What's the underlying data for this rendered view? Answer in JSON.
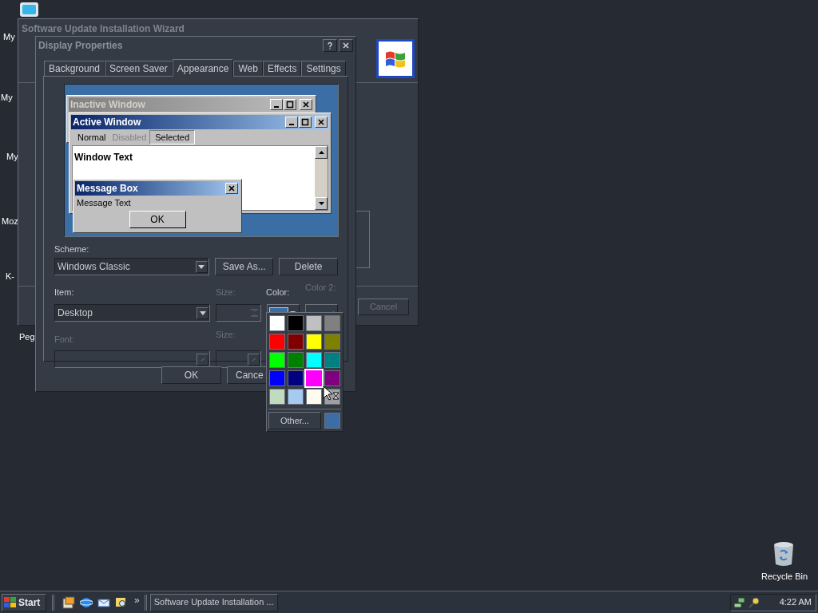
{
  "desktop_icons": [
    {
      "label": "My"
    },
    {
      "label": "My"
    },
    {
      "label": "My"
    },
    {
      "label": "Moz"
    },
    {
      "label": "K-"
    },
    {
      "label": "Peg"
    }
  ],
  "wizard": {
    "title": "Software Update Installation Wizard",
    "cancel": {
      "label": "Cancel",
      "disabled": true
    }
  },
  "dialog": {
    "title": "Display Properties",
    "tabs": [
      {
        "label": "Background",
        "selected": false
      },
      {
        "label": "Screen Saver",
        "selected": false
      },
      {
        "label": "Appearance",
        "selected": true
      },
      {
        "label": "Web",
        "selected": false
      },
      {
        "label": "Effects",
        "selected": false
      },
      {
        "label": "Settings",
        "selected": false
      }
    ],
    "preview": {
      "inactive_title": "Inactive Window",
      "active_title": "Active Window",
      "menu": [
        {
          "label": "Normal",
          "kind": "normal"
        },
        {
          "label": "Disabled",
          "kind": "disabled"
        },
        {
          "label": "Selected",
          "kind": "selected"
        }
      ],
      "window_text": "Window Text",
      "message_title": "Message Box",
      "message_text": "Message Text",
      "ok": "OK"
    },
    "scheme": {
      "label": "Scheme:",
      "value": "Windows Classic"
    },
    "save_as": "Save As...",
    "delete": "Delete",
    "item": {
      "label": "Item:",
      "value": "Desktop"
    },
    "item_size": {
      "label": "Size:",
      "disabled": true
    },
    "color": {
      "label": "Color:",
      "color": "#3a6ea5"
    },
    "color2": {
      "label": "Color 2:",
      "disabled": true
    },
    "font": {
      "label": "Font:",
      "disabled": true
    },
    "font_size": {
      "label": "Size:",
      "disabled": true
    },
    "buttons": [
      "OK",
      "Cance"
    ]
  },
  "color_menu": {
    "swatches": [
      {
        "color": "#ffffff",
        "selected": false
      },
      {
        "color": "#000000",
        "selected": false
      },
      {
        "color": "#c0c0c0",
        "selected": false
      },
      {
        "color": "#808080",
        "selected": false
      },
      {
        "color": "#ff0000",
        "selected": false
      },
      {
        "color": "#800000",
        "selected": false
      },
      {
        "color": "#ffff00",
        "selected": false
      },
      {
        "color": "#808000",
        "selected": false
      },
      {
        "color": "#00ff00",
        "selected": false
      },
      {
        "color": "#008000",
        "selected": false
      },
      {
        "color": "#00ffff",
        "selected": false
      },
      {
        "color": "#008080",
        "selected": false
      },
      {
        "color": "#0000ff",
        "selected": false
      },
      {
        "color": "#000080",
        "selected": false
      },
      {
        "color": "#ff00ff",
        "selected": true
      },
      {
        "color": "#800080",
        "selected": false
      },
      {
        "color": "#c0dcc0",
        "selected": false
      },
      {
        "color": "#a6caf0",
        "selected": false
      },
      {
        "color": "#fffbf0",
        "selected": false
      },
      {
        "color": "#a0a0a4",
        "selected": false
      }
    ],
    "other": "Other...",
    "current": {
      "color": "#3a6ea5"
    }
  },
  "taskbar": {
    "start": "Start",
    "overflow": "»",
    "tasks": [
      {
        "label": "Software Update Installation ...",
        "selected": false
      }
    ],
    "clock": "4:22 AM"
  },
  "recycle_bin": {
    "label": "Recycle Bin"
  }
}
